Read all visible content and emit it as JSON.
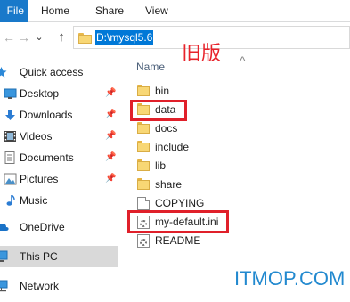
{
  "ribbon": {
    "file_tab": "File",
    "tabs": [
      "Home",
      "Share",
      "View"
    ]
  },
  "navigation": {
    "back": "←",
    "forward": "→",
    "recent": "⌄",
    "up": "↑"
  },
  "address": {
    "path": "D:\\mysql5.6"
  },
  "annotation": "旧版",
  "sidebar": {
    "items": [
      {
        "label": "Quick access",
        "icon": "star-icon",
        "pinned": false
      },
      {
        "label": "Desktop",
        "icon": "desktop-icon",
        "pinned": true
      },
      {
        "label": "Downloads",
        "icon": "download-icon",
        "pinned": true
      },
      {
        "label": "Videos",
        "icon": "video-icon",
        "pinned": true
      },
      {
        "label": "Documents",
        "icon": "documents-icon",
        "pinned": true
      },
      {
        "label": "Pictures",
        "icon": "pictures-icon",
        "pinned": true
      },
      {
        "label": "Music",
        "icon": "music-icon",
        "pinned": false
      },
      {
        "label": "OneDrive",
        "icon": "cloud-icon",
        "pinned": false
      },
      {
        "label": "This PC",
        "icon": "computer-icon",
        "pinned": false,
        "selected": true
      },
      {
        "label": "Network",
        "icon": "network-icon",
        "pinned": false
      }
    ]
  },
  "content": {
    "column_header": "Name",
    "files": [
      {
        "name": "bin",
        "type": "folder"
      },
      {
        "name": "data",
        "type": "folder",
        "highlighted": true
      },
      {
        "name": "docs",
        "type": "folder"
      },
      {
        "name": "include",
        "type": "folder"
      },
      {
        "name": "lib",
        "type": "folder"
      },
      {
        "name": "share",
        "type": "folder"
      },
      {
        "name": "COPYING",
        "type": "file"
      },
      {
        "name": "my-default.ini",
        "type": "ini",
        "highlighted": true
      },
      {
        "name": "README",
        "type": "file"
      }
    ]
  },
  "watermark": "ITMOP.COM",
  "colors": {
    "accent": "#1979ca",
    "selection": "#0078d7",
    "highlight_box": "#e0202a",
    "watermark": "#2289cf",
    "annotation": "#e8232b"
  }
}
